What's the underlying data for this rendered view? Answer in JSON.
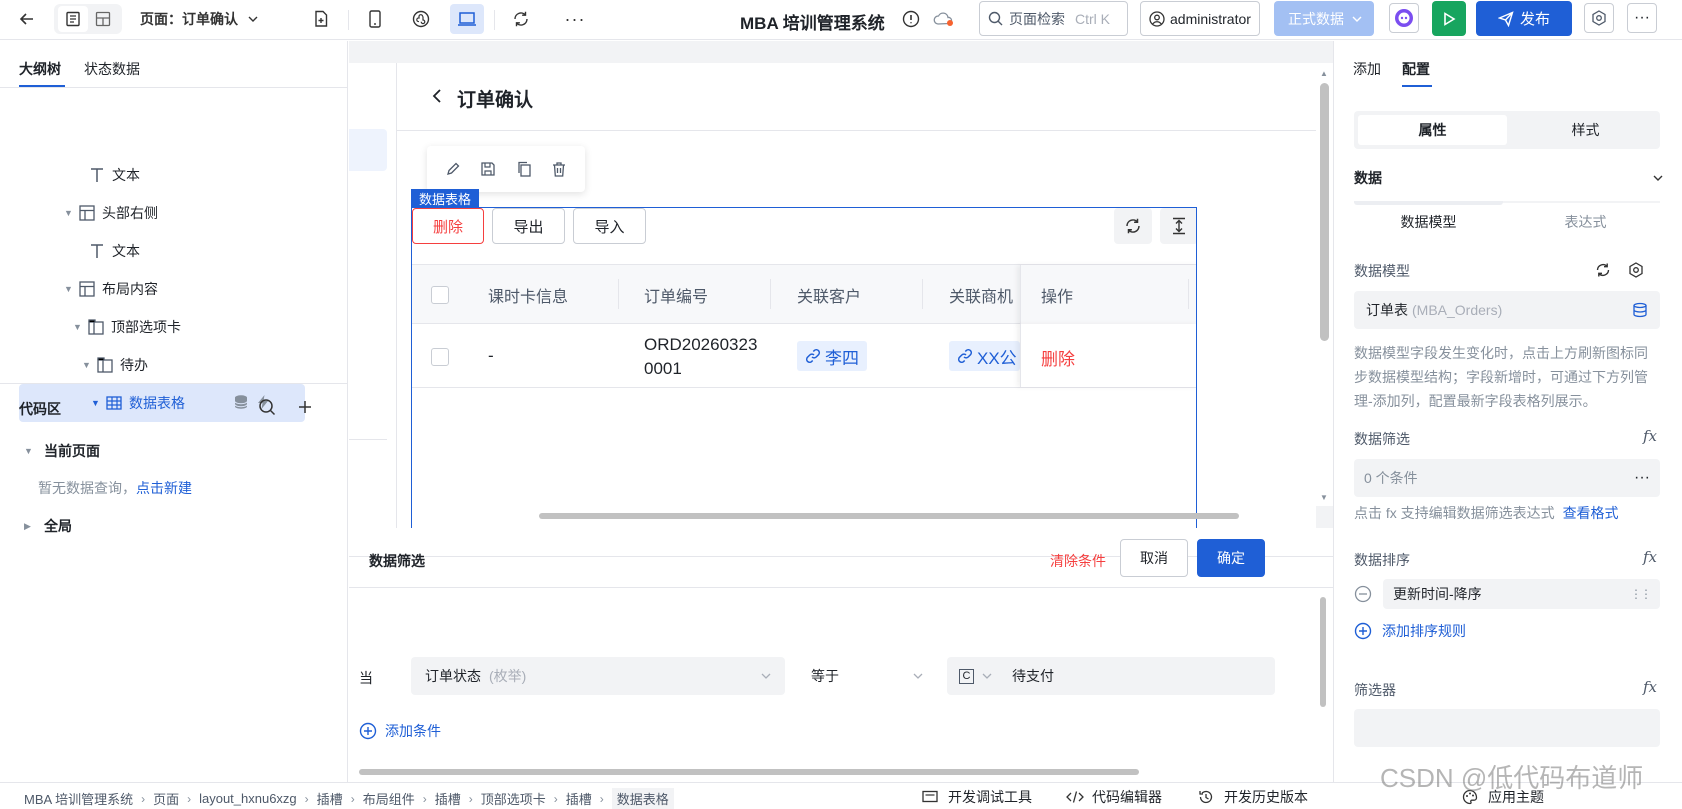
{
  "topbar": {
    "page_label": "页面：订单确认",
    "app_title": "MBA 培训管理系统",
    "search_placeholder": "页面检索",
    "search_shortcut": "Ctrl K",
    "user": "administrator",
    "env_label": "正式数据",
    "publish_label": "发布"
  },
  "left": {
    "tabs": [
      "大纲树",
      "状态数据"
    ],
    "tree": [
      {
        "label": "文本",
        "icon": "text-icon"
      },
      {
        "label": "头部右侧",
        "icon": "layout-icon"
      },
      {
        "label": "文本",
        "icon": "text-icon"
      },
      {
        "label": "布局内容",
        "icon": "layout-icon"
      },
      {
        "label": "顶部选项卡",
        "icon": "tabs-icon"
      },
      {
        "label": "待办",
        "icon": "tabs-icon"
      },
      {
        "label": "数据表格",
        "icon": "table-icon"
      }
    ],
    "code_title": "代码区",
    "current_page": "当前页面",
    "no_query": "暂无数据查询，",
    "create_link": "点击新建",
    "global": "全局"
  },
  "canvas": {
    "page_title": "订单确认",
    "component_tag": "数据表格",
    "buttons": [
      "删除",
      "导出",
      "导入"
    ],
    "columns": [
      "课时卡信息",
      "订单编号",
      "关联客户",
      "关联商机",
      "操作"
    ],
    "row": {
      "card": "-",
      "order_no_line1": "ORD20260323",
      "order_no_line2": "0001",
      "customer": "李四",
      "opportunity": "XX公",
      "action": "删除"
    }
  },
  "filter": {
    "title": "数据筛选",
    "clear": "清除条件",
    "cancel": "取消",
    "confirm": "确定",
    "when": "当",
    "field": "订单状态",
    "field_hint": "(枚举)",
    "operator": "等于",
    "value_type": "C",
    "value": "待支付",
    "add_condition": "添加条件"
  },
  "right": {
    "tabs": [
      "添加",
      "配置"
    ],
    "seg": [
      "属性",
      "样式"
    ],
    "section_data": "数据",
    "subtabs": [
      "数据模型",
      "表达式"
    ],
    "model_label": "数据模型",
    "model_value": "订单表",
    "model_code": "(MBA_Orders)",
    "model_help": "数据模型字段发生变化时，点击上方刷新图标同步数据模型结构；字段新增时，可通过下方列管理-添加列，配置最新字段表格列展示。",
    "filter_label": "数据筛选",
    "filter_value": "0 个条件",
    "filter_help": "点击 fx 支持编辑数据筛选表达式",
    "filter_help_link": "查看格式",
    "sort_label": "数据排序",
    "sort_rule": "更新时间-降序",
    "add_sort": "添加排序规则",
    "selector_label": "筛选器"
  },
  "bottombar": {
    "breadcrumb": [
      "MBA 培训管理系统",
      "页面",
      "layout_hxnu6xzg",
      "插槽",
      "布局组件",
      "插槽",
      "顶部选项卡",
      "插槽",
      "数据表格"
    ],
    "tools": [
      "开发调试工具",
      "代码编辑器",
      "开发历史版本",
      "应用主题"
    ],
    "watermark": "CSDN @低代码布道师"
  }
}
